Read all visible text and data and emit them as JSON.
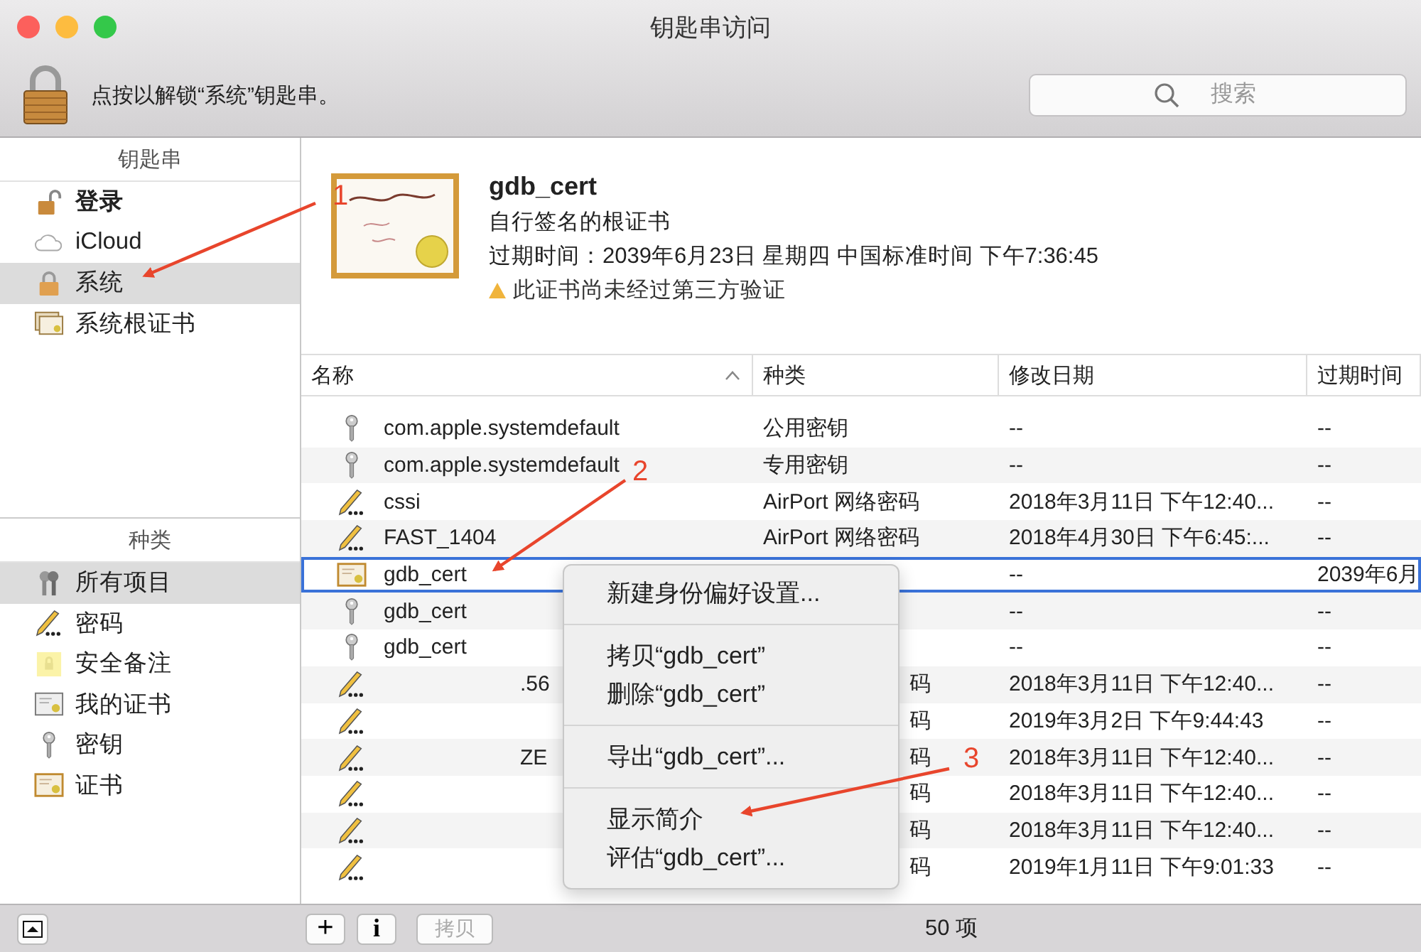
{
  "window": {
    "title": "钥匙串访问"
  },
  "toolbar": {
    "lock_message": "点按以解锁“系统”钥匙串。",
    "search": {
      "placeholder": "搜索"
    }
  },
  "sidebar": {
    "keychains_header": "钥匙串",
    "keychains": [
      {
        "label": "登录",
        "kind": "lock-open",
        "bold": true,
        "selected": false
      },
      {
        "label": "iCloud",
        "kind": "cloud",
        "bold": false,
        "selected": false
      },
      {
        "label": "系统",
        "kind": "lock",
        "bold": false,
        "selected": true
      },
      {
        "label": "系统根证书",
        "kind": "certs",
        "bold": false,
        "selected": false
      }
    ],
    "categories_header": "种类",
    "categories": [
      {
        "label": "所有项目",
        "kind": "keys",
        "selected": true
      },
      {
        "label": "密码",
        "kind": "pencil",
        "selected": false
      },
      {
        "label": "安全备注",
        "kind": "note",
        "selected": false
      },
      {
        "label": "我的证书",
        "kind": "mycert",
        "selected": false
      },
      {
        "label": "密钥",
        "kind": "key",
        "selected": false
      },
      {
        "label": "证书",
        "kind": "cert",
        "selected": false
      }
    ]
  },
  "detail": {
    "name": "gdb_cert",
    "subtitle": "自行签名的根证书",
    "expires": "过期时间：2039年6月23日 星期四 中国标准时间 下午7:36:45",
    "warning": "此证书尚未经过第三方验证"
  },
  "table": {
    "columns": [
      "名称",
      "种类",
      "修改日期",
      "过期时间"
    ],
    "rows": [
      {
        "kind": "key",
        "name": "com.apple.systemdefault",
        "category": "公用密钥",
        "modified": "--",
        "expires": "--",
        "selected": false
      },
      {
        "kind": "key",
        "name": "com.apple.systemdefault",
        "category": "专用密钥",
        "modified": "--",
        "expires": "--",
        "selected": false
      },
      {
        "kind": "pencil",
        "name": "cssi",
        "category": "AirPort 网络密码",
        "modified": "2018年3月11日 下午12:40...",
        "expires": "--",
        "selected": false
      },
      {
        "kind": "pencil",
        "name": "FAST_1404",
        "category": "AirPort 网络密码",
        "modified": "2018年4月30日 下午6:45:...",
        "expires": "--",
        "selected": false
      },
      {
        "kind": "cert",
        "name": "gdb_cert",
        "modified": "--",
        "expires": "2039年6月",
        "selected": true
      },
      {
        "kind": "key",
        "name": "gdb_cert",
        "modified": "--",
        "expires": "--",
        "selected": false
      },
      {
        "kind": "key",
        "name": "gdb_cert",
        "modified": "--",
        "expires": "--",
        "selected": false
      },
      {
        "kind": "pencil",
        "name_tail": ".56",
        "category_tail": "码",
        "modified": "2018年3月11日 下午12:40...",
        "expires": "--",
        "selected": false
      },
      {
        "kind": "pencil",
        "category_tail": "码",
        "modified": "2019年3月2日 下午9:44:43",
        "expires": "--",
        "selected": false
      },
      {
        "kind": "pencil",
        "name_tail": "ZE",
        "category_tail": "码",
        "modified": "2018年3月11日 下午12:40...",
        "expires": "--",
        "selected": false
      },
      {
        "kind": "pencil",
        "category_tail": "码",
        "modified": "2018年3月11日 下午12:40...",
        "expires": "--",
        "selected": false
      },
      {
        "kind": "pencil",
        "category_tail": "码",
        "modified": "2018年3月11日 下午12:40...",
        "expires": "--",
        "selected": false
      },
      {
        "kind": "pencil",
        "category_tail": "码",
        "modified": "2019年1月11日 下午9:01:33",
        "expires": "--",
        "selected": false
      }
    ]
  },
  "context_menu": {
    "groups": [
      [
        "新建身份偏好设置..."
      ],
      [
        "拷贝“gdb_cert”",
        "删除“gdb_cert”"
      ],
      [
        "导出“gdb_cert”..."
      ],
      [
        "显示简介",
        "评估“gdb_cert”..."
      ]
    ]
  },
  "bottom_bar": {
    "add": "+",
    "info": "i",
    "copy": {
      "label": "拷贝",
      "disabled": true
    },
    "count": "50 项"
  },
  "annotations": [
    {
      "label": "1"
    },
    {
      "label": "2"
    },
    {
      "label": "3"
    }
  ]
}
